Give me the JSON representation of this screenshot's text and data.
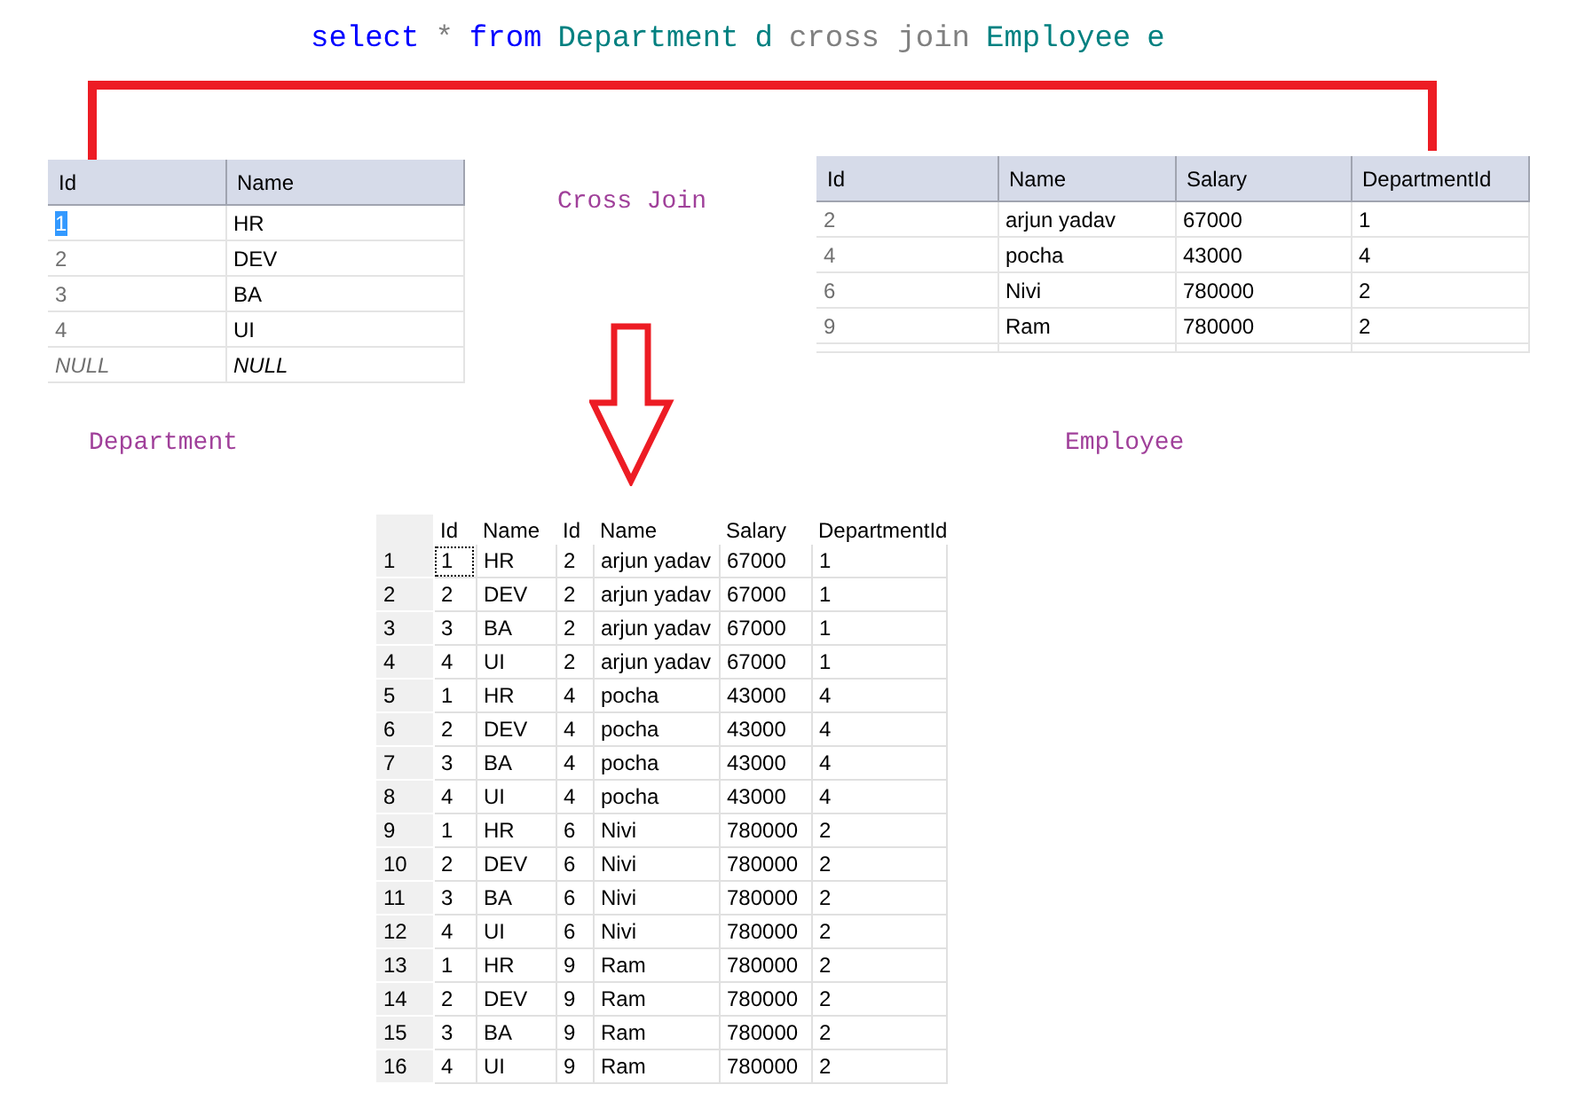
{
  "query": [
    {
      "text": "select",
      "kind": "keyword"
    },
    {
      "text": "*",
      "kind": "operator"
    },
    {
      "text": "from",
      "kind": "keyword"
    },
    {
      "text": "Department",
      "kind": "identifier"
    },
    {
      "text": "d",
      "kind": "identifier"
    },
    {
      "text": "cross join",
      "kind": "operator"
    },
    {
      "text": "Employee",
      "kind": "identifier"
    },
    {
      "text": "e",
      "kind": "identifier"
    }
  ],
  "department_table": {
    "columns": [
      "Id",
      "Name"
    ],
    "caption": "Department",
    "rows": [
      {
        "cells": [
          "1",
          "HR"
        ],
        "kind": "data",
        "focused": true
      },
      {
        "cells": [
          "2",
          "DEV"
        ],
        "kind": "data",
        "focused": false
      },
      {
        "cells": [
          "3",
          "BA"
        ],
        "kind": "data",
        "focused": false
      },
      {
        "cells": [
          "4",
          "UI"
        ],
        "kind": "data",
        "focused": false
      },
      {
        "cells": [
          "NULL",
          "NULL"
        ],
        "kind": "new",
        "focused": false
      }
    ]
  },
  "join_label": "Cross Join",
  "employee_table": {
    "columns": [
      "Id",
      "Name",
      "Salary",
      "DepartmentId"
    ],
    "caption": "Employee",
    "rows": [
      {
        "cells": [
          "2",
          "arjun yadav",
          "67000",
          "1"
        ],
        "focused": false
      },
      {
        "cells": [
          "4",
          "pocha",
          "43000",
          "4"
        ],
        "focused": false
      },
      {
        "cells": [
          "6",
          "Nivi",
          "780000",
          "2"
        ],
        "focused": false
      },
      {
        "cells": [
          "9",
          "Ram",
          "780000",
          "2"
        ],
        "focused": false
      }
    ]
  },
  "result_table": {
    "columns": [
      "Id",
      "Name",
      "Id",
      "Name",
      "Salary",
      "DepartmentId"
    ],
    "rows": [
      {
        "number": "1",
        "cells": [
          "1",
          "HR",
          "2",
          "arjun yadav",
          "67000",
          "1"
        ],
        "focused": true
      },
      {
        "number": "2",
        "cells": [
          "2",
          "DEV",
          "2",
          "arjun yadav",
          "67000",
          "1"
        ],
        "focused": false
      },
      {
        "number": "3",
        "cells": [
          "3",
          "BA",
          "2",
          "arjun yadav",
          "67000",
          "1"
        ],
        "focused": false
      },
      {
        "number": "4",
        "cells": [
          "4",
          "UI",
          "2",
          "arjun yadav",
          "67000",
          "1"
        ],
        "focused": false
      },
      {
        "number": "5",
        "cells": [
          "1",
          "HR",
          "4",
          "pocha",
          "43000",
          "4"
        ],
        "focused": false
      },
      {
        "number": "6",
        "cells": [
          "2",
          "DEV",
          "4",
          "pocha",
          "43000",
          "4"
        ],
        "focused": false
      },
      {
        "number": "7",
        "cells": [
          "3",
          "BA",
          "4",
          "pocha",
          "43000",
          "4"
        ],
        "focused": false
      },
      {
        "number": "8",
        "cells": [
          "4",
          "UI",
          "4",
          "pocha",
          "43000",
          "4"
        ],
        "focused": false
      },
      {
        "number": "9",
        "cells": [
          "1",
          "HR",
          "6",
          "Nivi",
          "780000",
          "2"
        ],
        "focused": false
      },
      {
        "number": "10",
        "cells": [
          "2",
          "DEV",
          "6",
          "Nivi",
          "780000",
          "2"
        ],
        "focused": false
      },
      {
        "number": "11",
        "cells": [
          "3",
          "BA",
          "6",
          "Nivi",
          "780000",
          "2"
        ],
        "focused": false
      },
      {
        "number": "12",
        "cells": [
          "4",
          "UI",
          "6",
          "Nivi",
          "780000",
          "2"
        ],
        "focused": false
      },
      {
        "number": "13",
        "cells": [
          "1",
          "HR",
          "9",
          "Ram",
          "780000",
          "2"
        ],
        "focused": false
      },
      {
        "number": "14",
        "cells": [
          "2",
          "DEV",
          "9",
          "Ram",
          "780000",
          "2"
        ],
        "focused": false
      },
      {
        "number": "15",
        "cells": [
          "3",
          "BA",
          "9",
          "Ram",
          "780000",
          "2"
        ],
        "focused": false
      },
      {
        "number": "16",
        "cells": [
          "4",
          "UI",
          "9",
          "Ram",
          "780000",
          "2"
        ],
        "focused": false
      }
    ]
  }
}
